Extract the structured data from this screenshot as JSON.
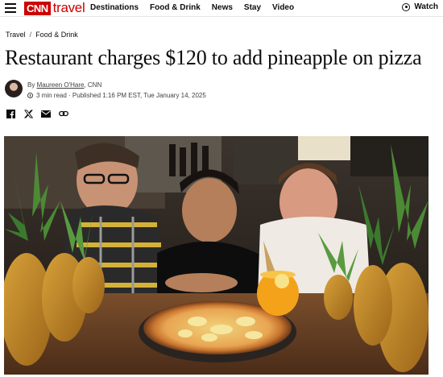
{
  "brand": {
    "logo_box": "CNN",
    "logo_text": "travel"
  },
  "nav": {
    "items": [
      "Destinations",
      "Food & Drink",
      "News",
      "Stay",
      "Video"
    ],
    "watch_label": "Watch"
  },
  "breadcrumb": {
    "items": [
      "Travel",
      "Food & Drink"
    ],
    "separator": "/"
  },
  "article": {
    "headline": "Restaurant charges $120 to add pineapple on pizza",
    "byline_prefix": "By ",
    "author": "Maureen O'Hare",
    "outlet": ", CNN",
    "read_time": "3 min read",
    "published": "· Published 1:16 PM EST, Tue January 14, 2025"
  },
  "share": [
    "facebook-icon",
    "x-icon",
    "email-icon",
    "link-icon"
  ],
  "colors": {
    "brand_red": "#cc0000",
    "text": "#0c0c0c",
    "meta": "#404040"
  }
}
